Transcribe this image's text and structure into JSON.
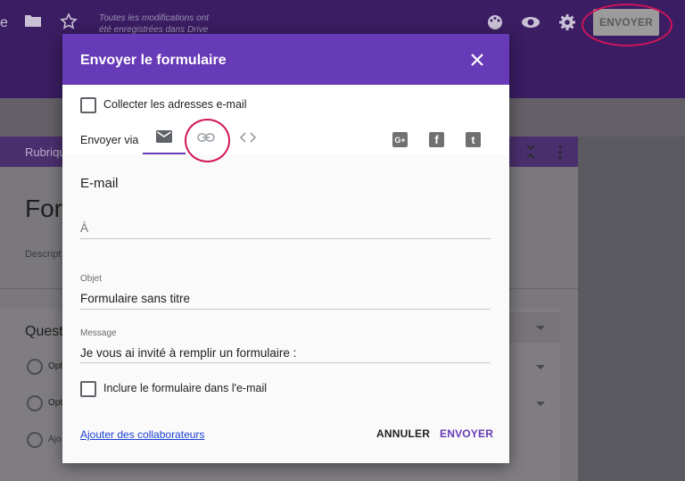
{
  "topbar": {
    "status_line1": "Toutes les modifications ont",
    "status_line2": "été enregistrées dans Drive",
    "send_label": "ENVOYER",
    "partial_left": "e"
  },
  "background": {
    "section_label": "Rubriqu",
    "form_title_partial": "For",
    "description_partial": "Descript",
    "question_partial": "Quest",
    "option1_partial": "Opt",
    "option2_partial": "Opt",
    "add_option_partial": "Ajo"
  },
  "dialog": {
    "title": "Envoyer le formulaire",
    "collect_emails_label": "Collecter les adresses e-mail",
    "send_via_label": "Envoyer via",
    "social": {
      "gplus": "G+",
      "facebook": "f",
      "twitter": "t"
    },
    "email_section_title": "E-mail",
    "to_placeholder": "À",
    "subject_caption": "Objet",
    "subject_value": "Formulaire sans titre",
    "message_caption": "Message",
    "message_value": "Je vous ai invité à remplir un formulaire :",
    "include_form_label": "Inclure le formulaire dans l'e-mail",
    "add_collaborators_link": "Ajouter des collaborateurs",
    "cancel_label": "ANNULER",
    "send_label": "ENVOYER"
  },
  "colors": {
    "accent": "#673ab7",
    "highlight_ring": "#d0145a",
    "link": "#1a3fd6"
  },
  "icons": [
    "folder-icon",
    "star-icon",
    "palette-icon",
    "eye-icon",
    "gear-icon",
    "close-icon",
    "email-icon",
    "link-icon",
    "embed-code-icon",
    "google-plus-icon",
    "facebook-icon",
    "twitter-icon",
    "collapse-icon",
    "more-vert-icon"
  ]
}
